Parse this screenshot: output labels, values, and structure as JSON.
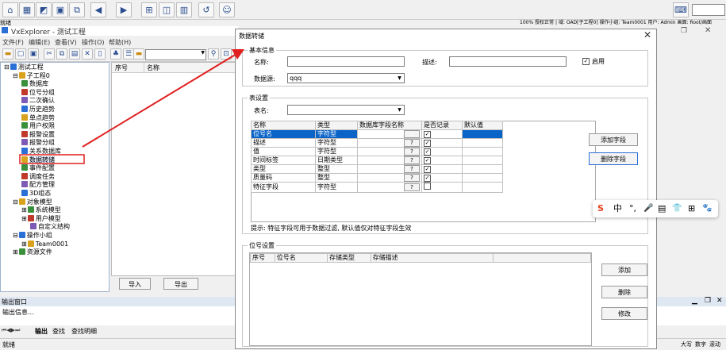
{
  "top_status": "100% 授权正常 | 域: OAD[子工程0] 操作小组: Team0001 用户: Admin 画面: Root/画面",
  "app_title": "VxExplorer - 测试工程",
  "menu": [
    "文件(F)",
    "编辑(E)",
    "查看(V)",
    "操作(O)",
    "帮助(H)"
  ],
  "corner_label": "就绪",
  "tree": [
    {
      "label": "测试工程",
      "depth": 0,
      "prefix": "⊟"
    },
    {
      "label": "子工程0",
      "depth": 1,
      "prefix": "⊟"
    },
    {
      "label": "数据库",
      "depth": 2,
      "prefix": ""
    },
    {
      "label": "位号分组",
      "depth": 2,
      "prefix": ""
    },
    {
      "label": "二次确认",
      "depth": 2,
      "prefix": ""
    },
    {
      "label": "历史趋势",
      "depth": 2,
      "prefix": ""
    },
    {
      "label": "单点趋势",
      "depth": 2,
      "prefix": ""
    },
    {
      "label": "用户权限",
      "depth": 2,
      "prefix": ""
    },
    {
      "label": "报警设置",
      "depth": 2,
      "prefix": ""
    },
    {
      "label": "报警分组",
      "depth": 2,
      "prefix": ""
    },
    {
      "label": "关系数据库",
      "depth": 2,
      "prefix": ""
    },
    {
      "label": "数据转储",
      "depth": 2,
      "prefix": "",
      "selected": true
    },
    {
      "label": "事件配置",
      "depth": 2,
      "prefix": ""
    },
    {
      "label": "调度任务",
      "depth": 2,
      "prefix": ""
    },
    {
      "label": "配方管理",
      "depth": 2,
      "prefix": ""
    },
    {
      "label": "3D组态",
      "depth": 2,
      "prefix": ""
    },
    {
      "label": "对象模型",
      "depth": 1,
      "prefix": "⊟"
    },
    {
      "label": "系统模型",
      "depth": 2,
      "prefix": "⊞"
    },
    {
      "label": "用户模型",
      "depth": 2,
      "prefix": "⊞"
    },
    {
      "label": "自定义结构",
      "depth": 3,
      "prefix": ""
    },
    {
      "label": "操作小组",
      "depth": 1,
      "prefix": "⊟"
    },
    {
      "label": "Team0001",
      "depth": 2,
      "prefix": "⊞"
    },
    {
      "label": "资源文件",
      "depth": 1,
      "prefix": "⊞"
    }
  ],
  "list": {
    "col1": "序号",
    "col2": "名称"
  },
  "list_buttons": {
    "import": "导入",
    "export": "导出"
  },
  "output": {
    "title": "输出窗口",
    "text": "输出信息..."
  },
  "bottom_tabs": [
    "输出",
    "查找",
    "查找明细"
  ],
  "statusbar": {
    "left": "就绪",
    "caps": "大写",
    "num": "数字",
    "scroll": "滚动"
  },
  "dialog": {
    "title": "数据转储",
    "basic": {
      "group": "基本信息",
      "name_label": "名称:",
      "name_value": "",
      "desc_label": "描述:",
      "desc_value": "",
      "enable_label": "启用",
      "enable_checked": "✓",
      "source_label": "数据源:",
      "source_value": "qqq"
    },
    "table": {
      "group": "表设置",
      "name_label": "表名:",
      "name_value": "",
      "headers": [
        "名称",
        "类型",
        "数据库字段名称",
        "是否记录",
        "默认值"
      ],
      "rows": [
        {
          "name": "位号名",
          "type": "字符型",
          "check": "✓",
          "selected": true
        },
        {
          "name": "描述",
          "type": "字符型",
          "check": "✓"
        },
        {
          "name": "值",
          "type": "字符型",
          "check": "✓"
        },
        {
          "name": "时间标签",
          "type": "日期类型",
          "check": "✓"
        },
        {
          "name": "类型",
          "type": "整型",
          "check": "✓"
        },
        {
          "name": "质量码",
          "type": "整型",
          "check": "✓"
        },
        {
          "name": "特征字段",
          "type": "字符型",
          "check": ""
        }
      ],
      "qmark": "?",
      "add_field": "添加字段",
      "del_field": "删除字段",
      "hint": "提示: 特征字段可用于数据过滤, 默认值仅对特征字段生效"
    },
    "points": {
      "group": "位号设置",
      "headers": [
        "序号",
        "位号名",
        "存储类型",
        "存储描述"
      ],
      "add": "添加",
      "delete": "删除",
      "modify": "修改"
    }
  },
  "ime_bar": [
    "S",
    "中",
    "°,",
    "🎤",
    "▤",
    "👕",
    "⊞",
    "🐾"
  ]
}
